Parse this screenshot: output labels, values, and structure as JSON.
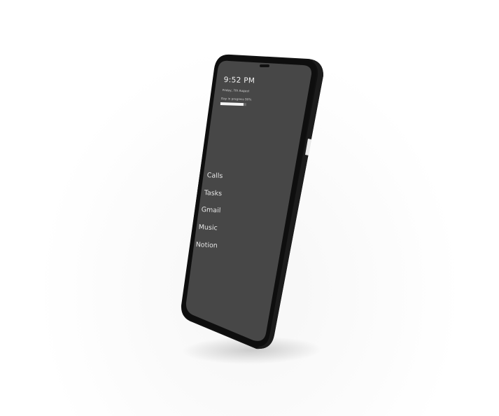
{
  "status": {
    "time": "9:52 PM",
    "date": "Friday, 7th August",
    "progress_label": "Day in progress 90%",
    "progress_value": 0.9
  },
  "apps": [
    {
      "label": "Calls"
    },
    {
      "label": "Tasks"
    },
    {
      "label": "Gmail"
    },
    {
      "label": "Music"
    },
    {
      "label": "Notion"
    }
  ],
  "colors": {
    "screen": "#474747",
    "bezel": "#0c0c0c",
    "text": "#e6e6e6"
  }
}
